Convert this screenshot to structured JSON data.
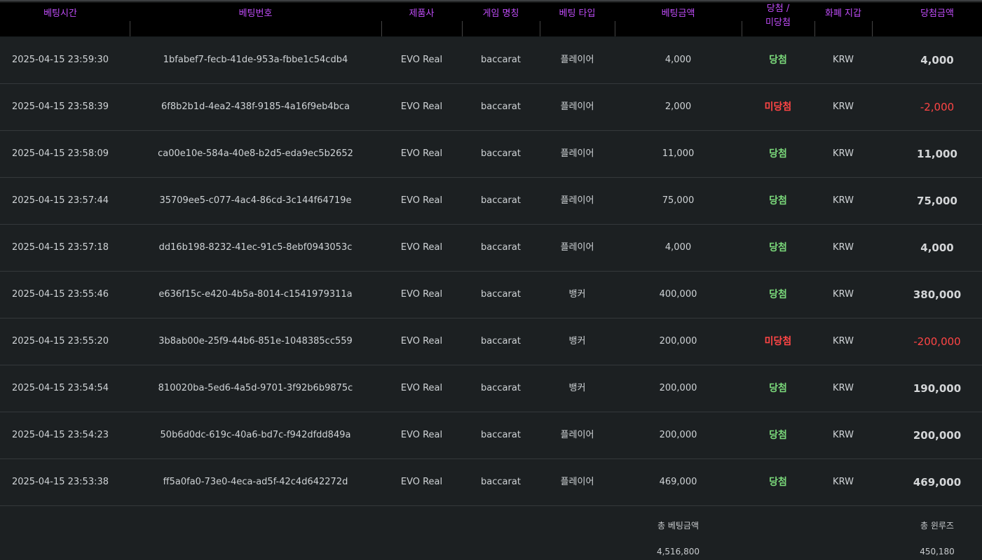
{
  "headers": {
    "bet_time": "베팅시간",
    "bet_id": "베팅번호",
    "vendor": "제품사",
    "game_name": "게임 명칭",
    "bet_type": "베팅 타입",
    "bet_amount": "베팅금액",
    "result_line1": "당첨 /",
    "result_line2": "미당첨",
    "currency_wallet": "화폐 지갑",
    "win_amount": "당첨금액"
  },
  "rows": [
    {
      "time": "2025-04-15 23:59:30",
      "id": "1bfabef7-fecb-41de-953a-fbbe1c54cdb4",
      "vendor": "EVO Real",
      "game": "baccarat",
      "type": "플레이어",
      "bet": "4,000",
      "result": "당첨",
      "currency": "KRW",
      "win": "4,000"
    },
    {
      "time": "2025-04-15 23:58:39",
      "id": "6f8b2b1d-4ea2-438f-9185-4a16f9eb4bca",
      "vendor": "EVO Real",
      "game": "baccarat",
      "type": "플레이어",
      "bet": "2,000",
      "result": "미당첨",
      "currency": "KRW",
      "win": "-2,000"
    },
    {
      "time": "2025-04-15 23:58:09",
      "id": "ca00e10e-584a-40e8-b2d5-eda9ec5b2652",
      "vendor": "EVO Real",
      "game": "baccarat",
      "type": "플레이어",
      "bet": "11,000",
      "result": "당첨",
      "currency": "KRW",
      "win": "11,000"
    },
    {
      "time": "2025-04-15 23:57:44",
      "id": "35709ee5-c077-4ac4-86cd-3c144f64719e",
      "vendor": "EVO Real",
      "game": "baccarat",
      "type": "플레이어",
      "bet": "75,000",
      "result": "당첨",
      "currency": "KRW",
      "win": "75,000"
    },
    {
      "time": "2025-04-15 23:57:18",
      "id": "dd16b198-8232-41ec-91c5-8ebf0943053c",
      "vendor": "EVO Real",
      "game": "baccarat",
      "type": "플레이어",
      "bet": "4,000",
      "result": "당첨",
      "currency": "KRW",
      "win": "4,000"
    },
    {
      "time": "2025-04-15 23:55:46",
      "id": "e636f15c-e420-4b5a-8014-c1541979311a",
      "vendor": "EVO Real",
      "game": "baccarat",
      "type": "뱅커",
      "bet": "400,000",
      "result": "당첨",
      "currency": "KRW",
      "win": "380,000"
    },
    {
      "time": "2025-04-15 23:55:20",
      "id": "3b8ab00e-25f9-44b6-851e-1048385cc559",
      "vendor": "EVO Real",
      "game": "baccarat",
      "type": "뱅커",
      "bet": "200,000",
      "result": "미당첨",
      "currency": "KRW",
      "win": "-200,000"
    },
    {
      "time": "2025-04-15 23:54:54",
      "id": "810020ba-5ed6-4a5d-9701-3f92b6b9875c",
      "vendor": "EVO Real",
      "game": "baccarat",
      "type": "뱅커",
      "bet": "200,000",
      "result": "당첨",
      "currency": "KRW",
      "win": "190,000"
    },
    {
      "time": "2025-04-15 23:54:23",
      "id": "50b6d0dc-619c-40a6-bd7c-f942dfdd849a",
      "vendor": "EVO Real",
      "game": "baccarat",
      "type": "플레이어",
      "bet": "200,000",
      "result": "당첨",
      "currency": "KRW",
      "win": "200,000"
    },
    {
      "time": "2025-04-15 23:53:38",
      "id": "ff5a0fa0-73e0-4eca-ad5f-42c4d642272d",
      "vendor": "EVO Real",
      "game": "baccarat",
      "type": "플레이어",
      "bet": "469,000",
      "result": "당첨",
      "currency": "KRW",
      "win": "469,000"
    }
  ],
  "result_status": {
    "win": "당첨",
    "lose": "미당첨"
  },
  "footer": {
    "total_bet_label": "총 베팅금액",
    "total_bet_value": "4,516,800",
    "total_winloss_label": "총 윈루즈",
    "total_winloss_value": "450,180"
  },
  "colors": {
    "header_text": "#c04df9",
    "win": "#7bd97b",
    "lose": "#ff4545",
    "background": "#1c2022"
  }
}
